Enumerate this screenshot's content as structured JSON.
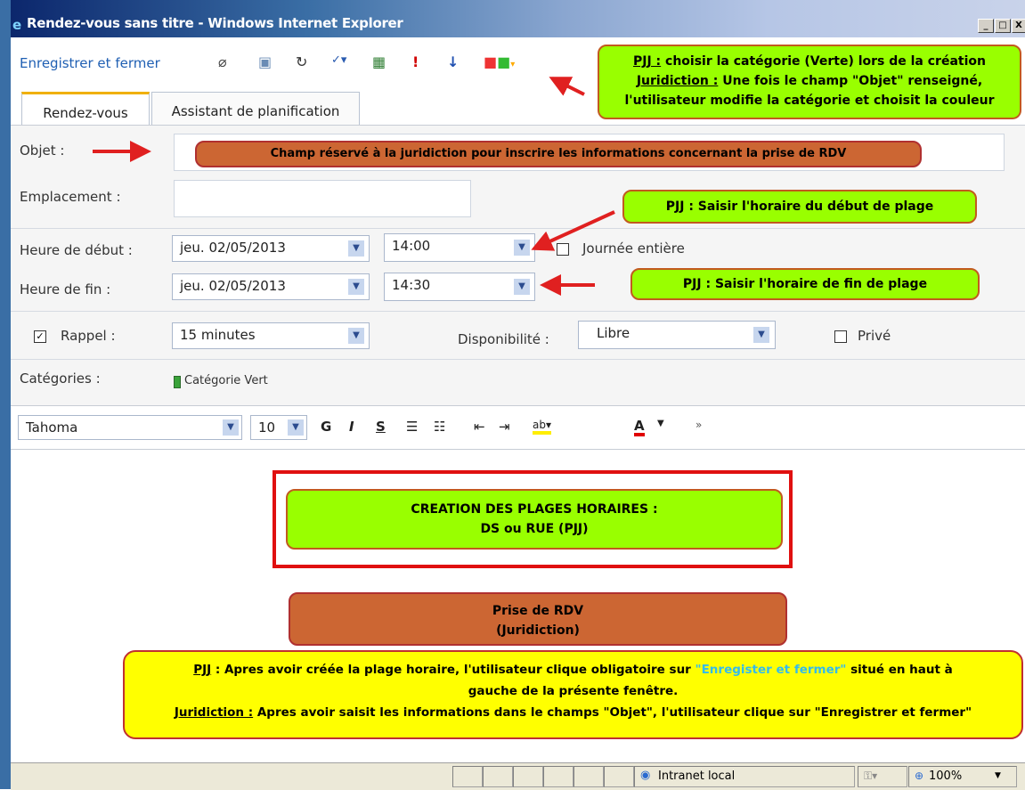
{
  "window": {
    "title": "Rendez-vous sans titre - Windows Internet Explorer",
    "controls": [
      "_",
      "□",
      "X"
    ]
  },
  "toolbar": {
    "save_close": "Enregistrer et fermer"
  },
  "tabs": [
    "Rendez-vous",
    "Assistant de planification"
  ],
  "form": {
    "subject_label": "Objet :",
    "location_label": "Emplacement :",
    "start_label": "Heure de début :",
    "start_date": "jeu. 02/05/2013",
    "start_time": "14:00",
    "allday_label": "Journée entière",
    "end_label": "Heure de fin :",
    "end_date": "jeu. 02/05/2013",
    "end_time": "14:30",
    "reminder_label": "Rappel :",
    "reminder_value": "15 minutes",
    "availability_label": "Disponibilité :",
    "availability_value": "Libre",
    "private_label": "Privé",
    "categories_label": "Catégories :",
    "category_value": "Catégorie Vert"
  },
  "format": {
    "font": "Tahoma",
    "size": "10",
    "bold": "G",
    "italic": "I",
    "underline": "S"
  },
  "annotations": {
    "top_right_l1_u": "PJJ :",
    "top_right_l1": " choisir la catégorie (Verte) lors de la création",
    "top_right_l2_u": "Juridiction :",
    "top_right_l2": " Une fois le champ \"Objet\" renseigné,",
    "top_right_l3": "l'utilisateur modifie la catégorie et choisit la couleur",
    "subject_note": "Champ réservé à la juridiction pour inscrire les informations concernant la prise de RDV",
    "start_note": "PJJ : Saisir l'horaire du début de plage",
    "end_note": "PJJ : Saisir l'horaire de fin de plage",
    "creation_l1": "CREATION DES PLAGES HORAIRES :",
    "creation_l2": "DS ou RUE (PJJ)",
    "prise_l1": "Prise de RDV",
    "prise_l2": "(Juridiction)",
    "bottom_l1_u": "PJJ",
    "bottom_l1a": " : Apres avoir créée la plage horaire, l'utilisateur clique obligatoire sur ",
    "bottom_l1_cyan": "\"Enregister et fermer\"",
    "bottom_l1b": " situé en haut à",
    "bottom_l2": "gauche de la présente fenêtre.",
    "bottom_l3_u": "Juridiction :",
    "bottom_l3": " Apres avoir saisit les informations dans le champs \"Objet\", l'utilisateur clique sur \"Enregistrer et fermer\""
  },
  "status": {
    "zone": "Intranet local",
    "zoom": "100%"
  },
  "colors": {
    "annotation_green": "#99ff00",
    "annotation_orange": "#cc6633",
    "annotation_yellow": "#ffff00",
    "arrow_red": "#e02020",
    "link_blue": "#1f5fb3",
    "cyan_text": "#33bbee"
  }
}
